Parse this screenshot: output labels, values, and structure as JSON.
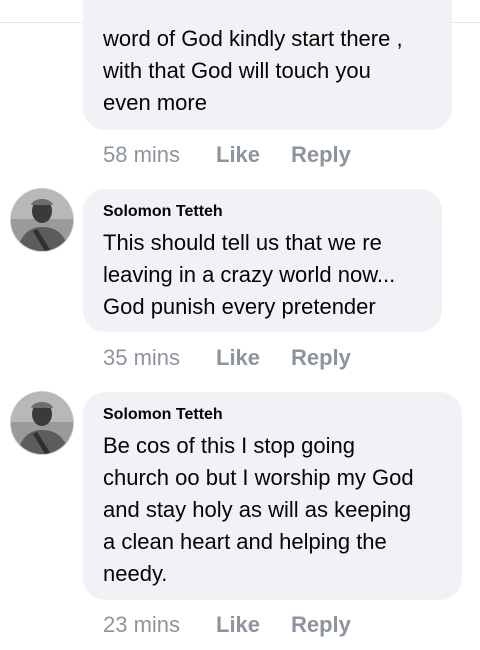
{
  "comments": [
    {
      "author": "",
      "text": "word of God kindly start there ,\nwith that God will touch you\neven more",
      "time": "58 mins",
      "like": "Like",
      "reply": "Reply"
    },
    {
      "author": "Solomon Tetteh",
      "avatar": "person-avatar-icon",
      "text": "This should tell us that we re\nleaving in a crazy world now...\nGod punish every pretender",
      "time": "35 mins",
      "like": "Like",
      "reply": "Reply"
    },
    {
      "author": "Solomon Tetteh",
      "avatar": "person-avatar-icon",
      "text": "Be cos of this I stop going\nchurch oo but I worship my God\nand stay holy as will as keeping\na clean heart and helping  the\nneedy.",
      "time": "23 mins",
      "like": "Like",
      "reply": "Reply"
    }
  ],
  "colors": {
    "bubble": "#f0f2f5",
    "meta_text": "#8d949e",
    "body_text": "#050505"
  }
}
